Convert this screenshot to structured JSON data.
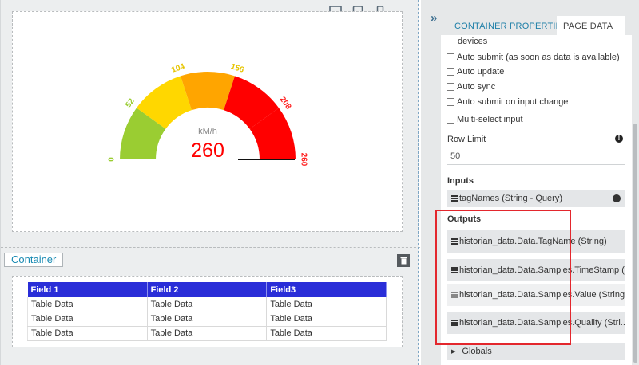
{
  "device_bar": {
    "desktop_icon": "desktop-icon",
    "tablet_icon": "tablet-icon",
    "phone_icon": "phone-icon"
  },
  "gauge": {
    "min": 0,
    "max": 260,
    "value": 260,
    "unit": "kM/h",
    "value_label": "260",
    "ticks": [
      "0",
      "52",
      "104",
      "156",
      "208",
      "260"
    ],
    "band_colors": [
      "#9acd32",
      "#ffd700",
      "#ffa500",
      "#ff0000"
    ],
    "tick_colors": [
      "#9acd32",
      "#9acd32",
      "#e6c400",
      "#e6c400",
      "#ff2020",
      "#ff2020"
    ],
    "value_color": "#ff0000"
  },
  "container": {
    "label": "Container",
    "delete_icon": "trash-icon"
  },
  "table": {
    "headers": [
      "Field 1",
      "Field 2",
      "Field3"
    ],
    "rows": [
      [
        "Table Data",
        "Table Data",
        "Table Data"
      ],
      [
        "Table Data",
        "Table Data",
        "Table Data"
      ],
      [
        "Table Data",
        "Table Data",
        "Table Data"
      ]
    ],
    "header_color": "#2a2ed8"
  },
  "panel": {
    "collapse_icon": "double-chevron-right-icon",
    "tabs": [
      {
        "label": "CONTAINER PROPERTIES",
        "active": false
      },
      {
        "label": "PAGE DATA",
        "active": true
      }
    ],
    "devices_text": "devices",
    "checkboxes": [
      {
        "label": "Auto submit (as soon as data is available)",
        "checked": false
      },
      {
        "label": "Auto update",
        "checked": false
      },
      {
        "label": "Auto sync",
        "checked": false
      },
      {
        "label": "Auto submit on input change",
        "checked": false
      },
      {
        "label": "Multi-select input",
        "checked": false
      }
    ],
    "row_limit": {
      "label": "Row Limit",
      "value": "50",
      "info_icon": "info-icon"
    },
    "inputs": {
      "heading": "Inputs",
      "items": [
        {
          "label": "tagNames (String - Query)",
          "icon": "globe-icon"
        }
      ]
    },
    "outputs": {
      "heading": "Outputs",
      "items": [
        {
          "label": "historian_data.Data.TagName (String)"
        },
        {
          "label": "historian_data.Data.Samples.TimeStamp (..."
        },
        {
          "label": "historian_data.Data.Samples.Value (String)"
        },
        {
          "label": "historian_data.Data.Samples.Quality (Stri..."
        }
      ]
    },
    "globals": {
      "label": "Globals",
      "icon": "caret-right-icon"
    },
    "highlight_color": "#e3272d"
  }
}
